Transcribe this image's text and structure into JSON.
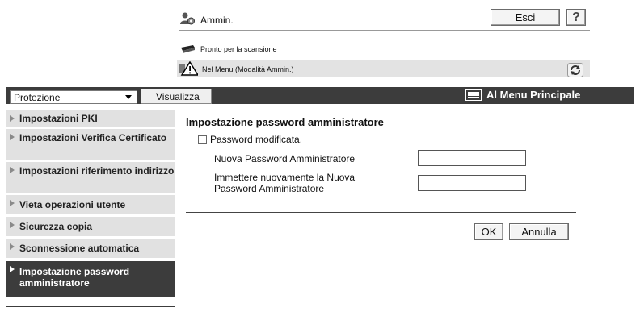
{
  "header": {
    "user": "Ammin.",
    "logout_label": "Esci",
    "help_label": "?",
    "status_scan": "Pronto per la scansione",
    "status_menu": "Nel Menu (Modalità Ammin.)"
  },
  "toolbar": {
    "select_value": "Protezione",
    "view_label": "Visualizza",
    "main_menu_label": "Al Menu Principale"
  },
  "sidebar": {
    "items": [
      {
        "label": "Impostazioni PKI"
      },
      {
        "label": "Impostazioni Verifica Certificato"
      },
      {
        "label": "Impostazioni riferimento indirizzo"
      },
      {
        "label": "Vieta operazioni utente"
      },
      {
        "label": "Sicurezza copia"
      },
      {
        "label": "Sconnessione automatica"
      },
      {
        "label": "Impostazione password amministratore"
      }
    ]
  },
  "main": {
    "title": "Impostazione password amministratore",
    "checkbox_label": "Password modificata.",
    "new_password_label": "Nuova Password Amministratore",
    "confirm_password_label": "Immettere nuovamente la Nuova Password Amministratore",
    "new_password_value": "",
    "confirm_password_value": "",
    "ok_label": "OK",
    "cancel_label": "Annulla"
  },
  "colors": {
    "dark_bar": "#3c3c3c",
    "sidebar_bg": "#e1e1e1",
    "status_bg": "#e3e3e3"
  }
}
